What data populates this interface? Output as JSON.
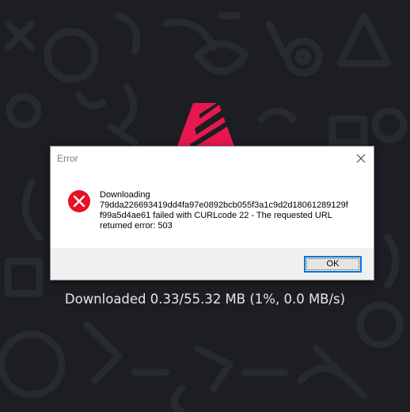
{
  "dialog": {
    "title": "Error",
    "message_lines": [
      "Downloading",
      "79dda226693419dd4fa97e0892bcb055f3a1c9d2d18061289129f",
      "f99a5d4ae61 failed with CURLcode 22 - The requested URL",
      "returned error: 503"
    ],
    "ok_label": "OK",
    "icon": "error-x-icon"
  },
  "status": {
    "text": "Downloaded 0.33/55.32 MB (1%, 0.0 MB/s)"
  },
  "colors": {
    "background": "#1c1e23",
    "pattern": "#2a2d34",
    "logo_accent": "#e8174f",
    "error_icon": "#e81123",
    "button_border": "#0078d7"
  }
}
